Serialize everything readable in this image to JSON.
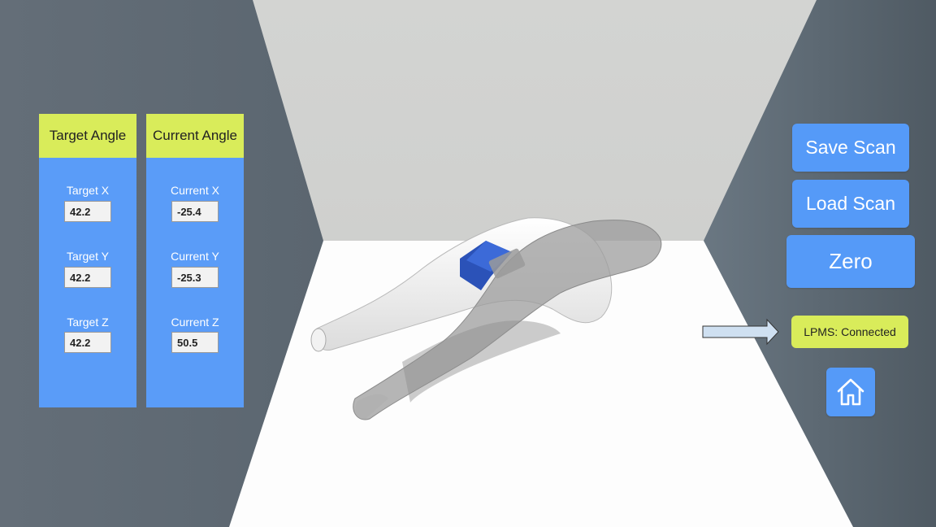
{
  "target_panel": {
    "header": "Target Angle",
    "fields": [
      {
        "label": "Target X",
        "value": "42.2"
      },
      {
        "label": "Target Y",
        "value": "42.2"
      },
      {
        "label": "Target Z",
        "value": "42.2"
      }
    ]
  },
  "current_panel": {
    "header": "Current Angle",
    "fields": [
      {
        "label": "Current X",
        "value": "-25.4"
      },
      {
        "label": "Current Y",
        "value": "-25.3"
      },
      {
        "label": "Current Z",
        "value": "50.5"
      }
    ]
  },
  "buttons": {
    "save_scan": "Save Scan",
    "load_scan": "Load Scan",
    "zero": "Zero"
  },
  "status": {
    "lpms": "LPMS: Connected"
  },
  "icons": {
    "home": "home-icon",
    "arrow": "right-arrow-icon"
  },
  "colors": {
    "panel_blue": "#5a9cf8",
    "header_yellow": "#d9ec5a",
    "button_blue": "#559af8",
    "sensor_blue": "#2b52b8",
    "wall_gray": "#5f6b75"
  }
}
